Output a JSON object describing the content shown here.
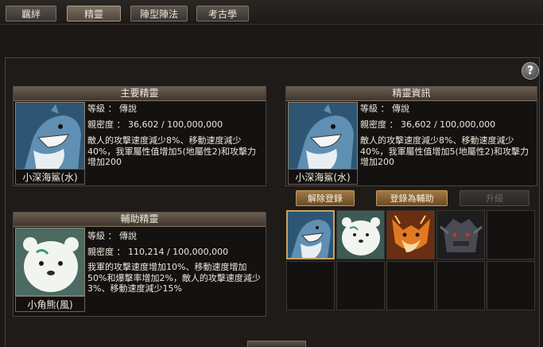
{
  "tabs": [
    "羈絆",
    "精靈",
    "陣型陣法",
    "考古學"
  ],
  "help_label": "?",
  "main_spirit": {
    "header": "主要精靈",
    "name": "小深海鯊(水)",
    "level_line": "等級 ： 傳說",
    "affinity_line": "親密度 ： 36,602 / 100,000,000",
    "description": "敵人的攻擊速度減少8%、移動速度減少40%，我軍屬性值增加5(地屬性2)和攻擊力增加200"
  },
  "assist_spirit": {
    "header": "輔助精靈",
    "name": "小角熊(風)",
    "level_line": "等級 ： 傳說",
    "affinity_line": "親密度 ： 110,214 / 100,000,000",
    "description": "我軍的攻擊速度增加10%、移動速度增加50%和爆擊率增加2%，敵人的攻擊速度減少3%、移動速度減少15%"
  },
  "spirit_info": {
    "header": "精靈資訊",
    "name": "小深海鯊(水)",
    "level_line": "等級 ： 傳說",
    "affinity_line": "親密度 ： 36,602 / 100,000,000",
    "description": "敵人的攻擊速度減少8%、移動速度減少40%，我軍屬性值增加5(地屬性2)和攻擊力增加200"
  },
  "buttons": {
    "unregister": "解除登錄",
    "register_assist": "登錄為輔助",
    "upgrade": "升級"
  },
  "inventory": [
    "shark-spirit",
    "bear-spirit",
    "fox-spirit",
    "armored-spirit",
    "",
    "",
    "",
    "",
    "",
    ""
  ]
}
